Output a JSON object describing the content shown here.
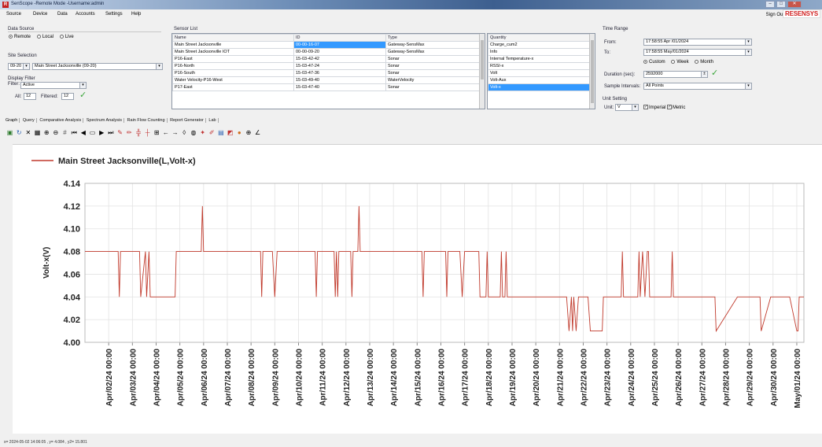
{
  "window": {
    "title": "SenScope -Remote Mode -Username:admin",
    "brand": "RESENSYS",
    "signout": "Sign Out"
  },
  "menu": [
    "Source",
    "Device",
    "Data",
    "Accounts",
    "Settings",
    "Help"
  ],
  "data_source": {
    "label": "Data Source",
    "options": [
      {
        "label": "Remote",
        "selected": true
      },
      {
        "label": "Local",
        "selected": false
      },
      {
        "label": "Live",
        "selected": false
      }
    ]
  },
  "site_selection": {
    "label": "Site Selection",
    "code": "09-20",
    "site": "Main Street Jacksonville (09-20)"
  },
  "display_filter": {
    "label": "Display Filter",
    "filter_label": "Filter:",
    "filter_value": "Active",
    "all_label": "All:",
    "all_value": "12",
    "filtered_label": "Filtered:",
    "filtered_value": "12"
  },
  "sensor_list": {
    "label": "Sensor List",
    "headers": [
      "Name",
      "ID",
      "Type"
    ],
    "rows": [
      {
        "name": "Main Street Jacksonville",
        "id": "00-00-16-07",
        "type": "Gateway-SensMax"
      },
      {
        "name": "Main Street Jacksonville IOT",
        "id": "00-00-09-20",
        "type": "Gateway-SensMax"
      },
      {
        "name": "P16-East",
        "id": "15-03-42-42",
        "type": "Sonar"
      },
      {
        "name": "P16-North",
        "id": "15-03-47-24",
        "type": "Sonar"
      },
      {
        "name": "P16-South",
        "id": "15-03-47-36",
        "type": "Sonar"
      },
      {
        "name": "Water Velocity-P16-West",
        "id": "15-03-49-40",
        "type": "WaterVelocity"
      },
      {
        "name": "P17-East",
        "id": "15-03-47-40",
        "type": "Sonar"
      }
    ]
  },
  "quantity_list": {
    "header": "Quantity",
    "items": [
      "Charge_cum2",
      "Info",
      "Internal Temperature-x",
      "RSSI-x",
      "Volt",
      "Volt-Aux",
      "Volt-x"
    ],
    "selected_index": 6
  },
  "time_range": {
    "label": "Time Range",
    "from_label": "From:",
    "from_value": "17:58:55   Apr /01/2024",
    "to_label": "To:",
    "to_value": "17:58:55   May/01/2024",
    "modes": [
      {
        "label": "Custom",
        "selected": true
      },
      {
        "label": "Week",
        "selected": false
      },
      {
        "label": "Month",
        "selected": false
      }
    ],
    "duration_label": "Duration (sec):",
    "duration_value": "2592000",
    "interval_label": "Sample Intervals:",
    "interval_value": "All Points"
  },
  "unit_setting": {
    "label": "Unit Setting",
    "unit_label": "Unit:",
    "unit_value": "V",
    "imperial": "Imperial",
    "metric": "Metric"
  },
  "tabs": [
    "Graph",
    "Query",
    "Comparative Analysis",
    "Spectrum Analysis",
    "Rain Flow Counting",
    "Report Generator",
    "Lab"
  ],
  "active_tab": 0,
  "status": "x= 2024-05-02 14:06:05 ,  y= 4.084 ,  y2= 15.801",
  "chart_data": {
    "type": "line",
    "legend": "Main Street Jacksonville(L,Volt-x)",
    "ylabel": "Volt-x(V)",
    "ylim": [
      4.0,
      4.14
    ],
    "yticks": [
      "4.14",
      "4.12",
      "4.10",
      "4.08",
      "4.06",
      "4.04",
      "4.02",
      "4.00"
    ],
    "xlim": [
      0.0,
      30.3
    ],
    "xticks": [
      "Apr/02/24 00:00",
      "Apr/03/24 00:00",
      "Apr/04/24 00:00",
      "Apr/05/24 00:00",
      "Apr/06/24 00:00",
      "Apr/07/24 00:00",
      "Apr/08/24 00:00",
      "Apr/09/24 00:00",
      "Apr/10/24 00:00",
      "Apr/11/24 00:00",
      "Apr/12/24 00:00",
      "Apr/13/24 00:00",
      "Apr/14/24 00:00",
      "Apr/15/24 00:00",
      "Apr/16/24 00:00",
      "Apr/17/24 00:00",
      "Apr/18/24 00:00",
      "Apr/19/24 00:00",
      "Apr/20/24 00:00",
      "Apr/21/24 00:00",
      "Apr/22/24 00:00",
      "Apr/23/24 00:00",
      "Apr/24/24 00:00",
      "Apr/25/24 00:00",
      "Apr/26/24 00:00",
      "Apr/27/24 00:00",
      "Apr/28/24 00:00",
      "Apr/29/24 00:00",
      "Apr/30/24 00:00",
      "May/01/24 00:00"
    ],
    "grid": true,
    "color": "#c0392b",
    "x": [
      0.0,
      1.4,
      1.45,
      1.5,
      1.55,
      2.3,
      2.35,
      2.55,
      2.6,
      2.7,
      2.75,
      3.8,
      3.85,
      4.9,
      4.95,
      5.0,
      5.5,
      5.55,
      5.6,
      6.0,
      6.05,
      6.5,
      7.4,
      7.45,
      7.5,
      7.9,
      8.0,
      8.1,
      8.6,
      9.7,
      9.75,
      9.8,
      10.5,
      10.55,
      10.6,
      10.65,
      10.7,
      11.2,
      11.25,
      11.3,
      11.5,
      11.55,
      11.6,
      14.2,
      14.25,
      14.3,
      15.2,
      15.25,
      15.3,
      15.8,
      15.9,
      16.0,
      16.6,
      16.65,
      16.7,
      16.9,
      16.95,
      17.0,
      17.3,
      17.5,
      17.55,
      17.6,
      17.7,
      17.75,
      17.8,
      18.0,
      18.5,
      18.6,
      18.7,
      19.2,
      20.1,
      20.3,
      20.4,
      20.5,
      20.55,
      20.6,
      20.7,
      20.8,
      21.2,
      21.3,
      21.8,
      21.85,
      21.9,
      22.2,
      22.6,
      22.65,
      22.7,
      23.3,
      23.35,
      23.4,
      23.5,
      23.6,
      23.7,
      23.75,
      23.8,
      24.1,
      24.7,
      24.75,
      24.8,
      25.0,
      25.2,
      26.2,
      26.5,
      26.55,
      26.6,
      27.5,
      27.8,
      28.4,
      28.45,
      28.5,
      28.9,
      29.6,
      29.65,
      29.7,
      30.0,
      30.05,
      30.1,
      30.3
    ],
    "y": [
      4.08,
      4.08,
      4.04,
      4.08,
      4.08,
      4.08,
      4.04,
      4.08,
      4.04,
      4.08,
      4.04,
      4.04,
      4.08,
      4.08,
      4.12,
      4.08,
      4.08,
      4.08,
      4.08,
      4.08,
      4.08,
      4.08,
      4.08,
      4.04,
      4.08,
      4.08,
      4.04,
      4.08,
      4.08,
      4.08,
      4.04,
      4.08,
      4.08,
      4.04,
      4.08,
      4.04,
      4.08,
      4.08,
      4.04,
      4.08,
      4.08,
      4.12,
      4.08,
      4.08,
      4.04,
      4.08,
      4.08,
      4.04,
      4.08,
      4.08,
      4.04,
      4.08,
      4.08,
      4.04,
      4.04,
      4.04,
      4.08,
      4.04,
      4.04,
      4.04,
      4.08,
      4.04,
      4.04,
      4.08,
      4.04,
      4.04,
      4.04,
      4.04,
      4.04,
      4.04,
      4.04,
      4.04,
      4.01,
      4.04,
      4.01,
      4.04,
      4.01,
      4.04,
      4.04,
      4.01,
      4.01,
      4.04,
      4.04,
      4.04,
      4.04,
      4.08,
      4.04,
      4.04,
      4.08,
      4.04,
      4.08,
      4.04,
      4.08,
      4.08,
      4.04,
      4.04,
      4.04,
      4.08,
      4.04,
      4.04,
      4.04,
      4.04,
      4.04,
      4.04,
      4.01,
      4.04,
      4.04,
      4.04,
      4.04,
      4.01,
      4.04,
      4.04,
      4.04,
      4.04,
      4.01,
      4.01,
      4.04,
      4.04,
      4.01,
      4.04
    ]
  }
}
